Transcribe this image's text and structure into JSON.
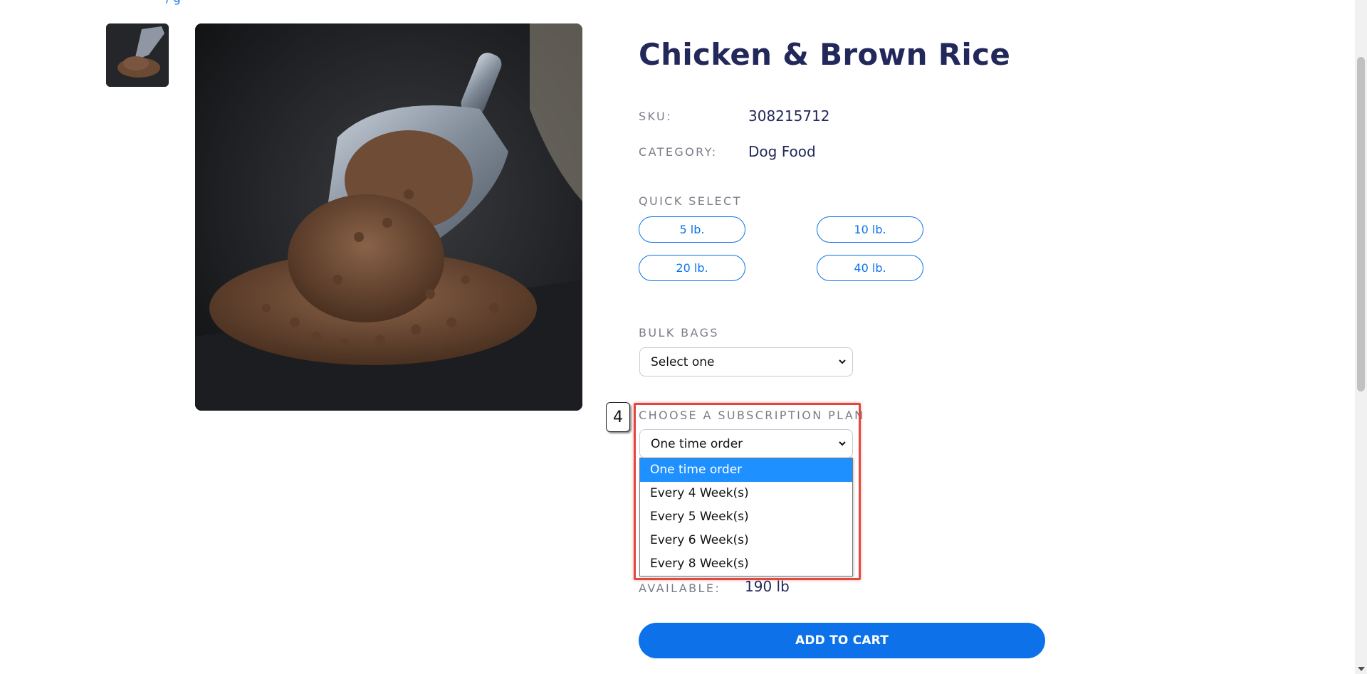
{
  "product": {
    "title": "Chicken & Brown Rice",
    "sku_label": "SKU:",
    "sku": "308215712",
    "category_label": "CATEGORY:",
    "category": "Dog Food"
  },
  "quick_select": {
    "label": "QUICK SELECT",
    "options": [
      "5 lb.",
      "10 lb.",
      "20 lb.",
      "40 lb."
    ]
  },
  "bulk_bags": {
    "label": "BULK BAGS",
    "value": "Select one"
  },
  "subscription": {
    "label": "CHOOSE A SUBSCRIPTION PLAN",
    "value": "One time order",
    "options": [
      "One time order",
      "Every 4 Week(s)",
      "Every 5 Week(s)",
      "Every 6 Week(s)",
      "Every 8 Week(s)"
    ],
    "annotation_number": "4"
  },
  "availability": {
    "label": "AVAILABLE:",
    "value": "190 lb"
  },
  "cart": {
    "button_label": "ADD TO CART"
  },
  "colors": {
    "accent": "#0d72ea",
    "title": "#22285a",
    "highlight": "#e2483e",
    "option_selected": "#1e90ff"
  }
}
